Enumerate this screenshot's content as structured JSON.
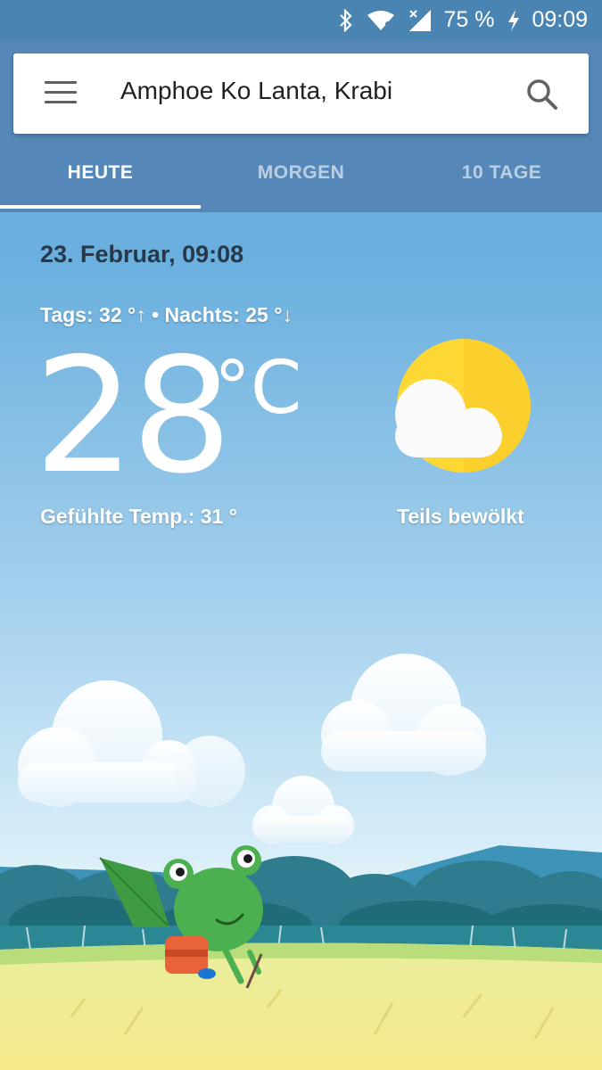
{
  "status_bar": {
    "battery": "75 %",
    "time": "09:09",
    "icons": [
      "bluetooth-icon",
      "wifi-icon",
      "signal-icon",
      "charging-icon"
    ]
  },
  "search": {
    "location": "Amphoe Ko Lanta, Krabi"
  },
  "tabs": [
    {
      "label": "HEUTE",
      "active": true
    },
    {
      "label": "MORGEN",
      "active": false
    },
    {
      "label": "10 TAGE",
      "active": false
    }
  ],
  "weather": {
    "date": "23. Februar, 09:08",
    "hi_lo": "Tags: 32 °↑ • Nachts: 25 °↓",
    "temperature": "28",
    "unit": "°C",
    "feels_like": "Gefühlte Temp.: 31 °",
    "condition": "Teils bewölkt",
    "condition_icon": "partly-cloudy-icon"
  },
  "colors": {
    "status_bar": "#4a84b3",
    "header": "#5588b8",
    "sky": "#6bb0df",
    "sun": "#fdd835",
    "frog": "#4caf50"
  }
}
